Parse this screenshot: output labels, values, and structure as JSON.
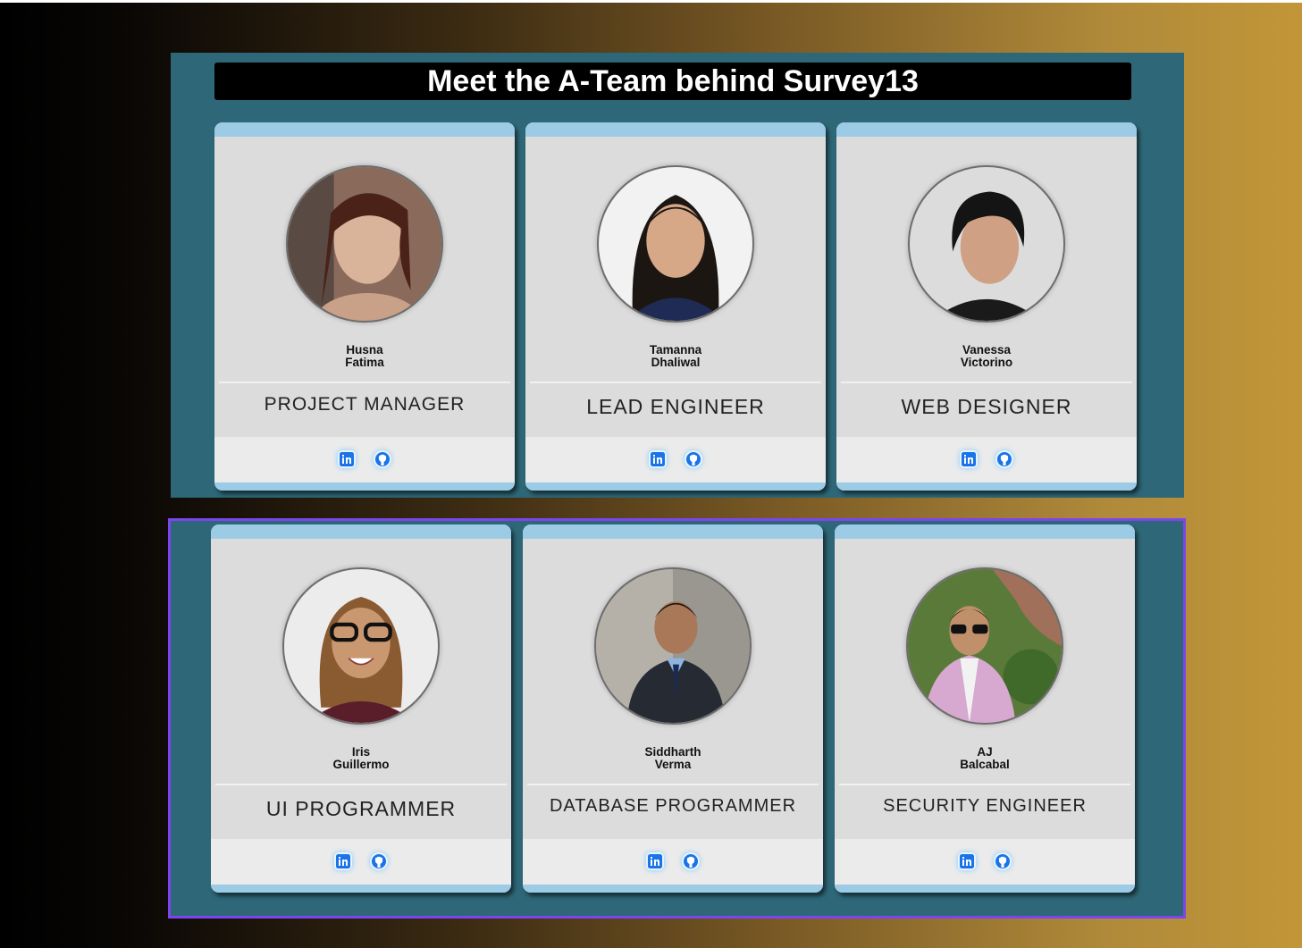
{
  "page": {
    "title": "Meet the A-Team behind Survey13"
  },
  "colors": {
    "panel": "#2e6777",
    "card": "#dcdcdc",
    "card_cap": "#9ccbe6",
    "highlight_border": "#7d45ee",
    "icon_blue": "#1a73e8"
  },
  "team": [
    {
      "first": "Husna",
      "last": "Fatima",
      "role": "PROJECT MANAGER",
      "links": [
        "linkedin-icon",
        "github-icon"
      ]
    },
    {
      "first": "Tamanna",
      "last": "Dhaliwal",
      "role": "LEAD ENGINEER",
      "links": [
        "linkedin-icon",
        "github-icon"
      ]
    },
    {
      "first": "Vanessa",
      "last": "Victorino",
      "role": "WEB DESIGNER",
      "links": [
        "linkedin-icon",
        "github-icon"
      ]
    },
    {
      "first": "Iris",
      "last": "Guillermo",
      "role": "UI PROGRAMMER",
      "links": [
        "linkedin-icon",
        "github-icon"
      ]
    },
    {
      "first": "Siddharth",
      "last": "Verma",
      "role": "DATABASE PROGRAMMER",
      "links": [
        "linkedin-icon",
        "github-icon"
      ]
    },
    {
      "first": "AJ",
      "last": "Balcabal",
      "role": "SECURITY ENGINEER",
      "links": [
        "linkedin-icon",
        "github-icon"
      ]
    }
  ]
}
